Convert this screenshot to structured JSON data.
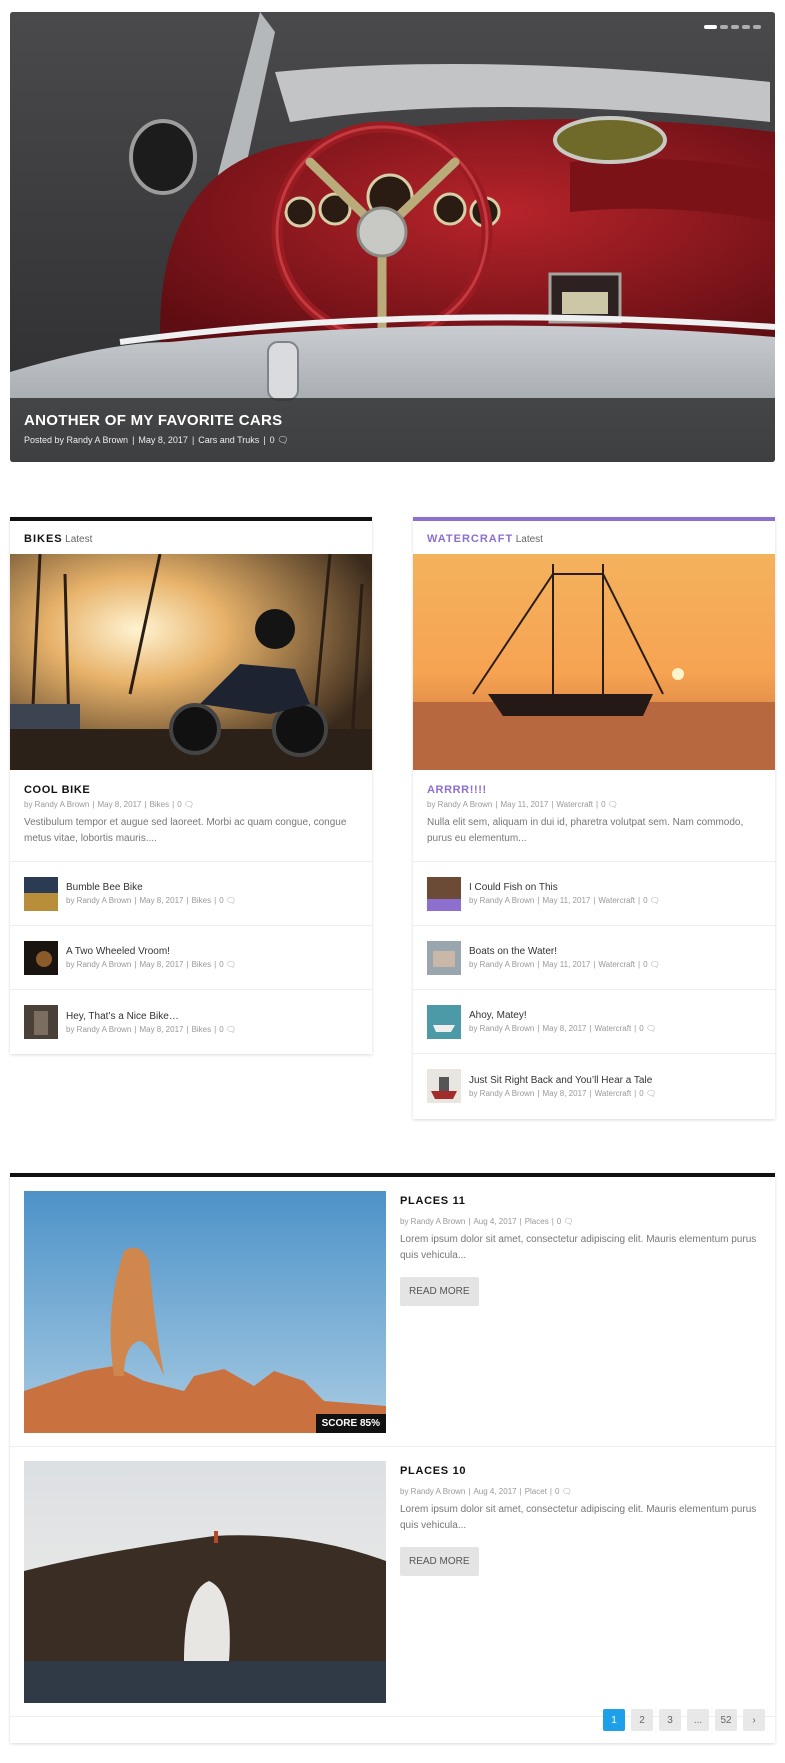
{
  "hero": {
    "title": "ANOTHER OF MY FAVORITE CARS",
    "posted_by": "Posted by Randy A Brown",
    "date": "May 8, 2017",
    "category": "Cars and Truks",
    "comments": "0",
    "comment_icon": "comment-icon",
    "dots": 5
  },
  "bikes": {
    "category": "BIKES",
    "latest": "Latest",
    "accent": "#111111",
    "main": {
      "title": "COOL BIKE",
      "author": "by Randy A Brown",
      "date": "May 8, 2017",
      "category": "Bikes",
      "comments": "0",
      "excerpt": "Vestibulum tempor et augue sed laoreet. Morbi ac quam congue, congue metus vitae, lobortis mauris...."
    },
    "items": [
      {
        "title": "Bumble Bee Bike",
        "author": "by Randy A Brown",
        "date": "May 8, 2017",
        "category": "Bikes",
        "comments": "0"
      },
      {
        "title": "A Two Wheeled Vroom!",
        "author": "by Randy A Brown",
        "date": "May 8, 2017",
        "category": "Bikes",
        "comments": "0"
      },
      {
        "title": "Hey, That’s a Nice Bike…",
        "author": "by Randy A Brown",
        "date": "May 8, 2017",
        "category": "Bikes",
        "comments": "0"
      }
    ]
  },
  "watercraft": {
    "category": "WATERCRAFT",
    "latest": "Latest",
    "accent": "#8c6fcf",
    "main": {
      "title": "ARRRR!!!!",
      "author": "by Randy A Brown",
      "date": "May 11, 2017",
      "category": "Watercraft",
      "comments": "0",
      "excerpt": "Nulla elit sem, aliquam in dui id, pharetra volutpat sem. Nam commodo, purus eu elementum..."
    },
    "items": [
      {
        "title": "I Could Fish on This",
        "author": "by Randy A Brown",
        "date": "May 11, 2017",
        "category": "Watercraft",
        "comments": "0"
      },
      {
        "title": "Boats on the Water!",
        "author": "by Randy A Brown",
        "date": "May 11, 2017",
        "category": "Watercraft",
        "comments": "0"
      },
      {
        "title": "Ahoy, Matey!",
        "author": "by Randy A Brown",
        "date": "May 8, 2017",
        "category": "Watercraft",
        "comments": "0"
      },
      {
        "title": "Just Sit Right Back and You’ll Hear a Tale",
        "author": "by Randy A Brown",
        "date": "May 8, 2017",
        "category": "Watercraft",
        "comments": "0"
      }
    ]
  },
  "places": [
    {
      "title": "PLACES 11",
      "author": "by Randy A Brown",
      "date": "Aug 4, 2017",
      "category": "Places",
      "comments": "0",
      "excerpt": "Lorem ipsum dolor sit amet, consectetur adipiscing elit. Mauris elementum purus quis vehicula...",
      "read_more": "READ MORE",
      "score": "SCORE 85%"
    },
    {
      "title": "PLACES 10",
      "author": "by Randy A Brown",
      "date": "Aug 4, 2017",
      "category": "Placet",
      "comments": "0",
      "excerpt": "Lorem ipsum dolor sit amet, consectetur adipiscing elit. Mauris elementum purus quis vehicula...",
      "read_more": "READ MORE"
    }
  ],
  "pagination": {
    "pages": [
      "1",
      "2",
      "3",
      "...",
      "52"
    ],
    "next": "›",
    "active": "1",
    "accent": "#1ea0e8"
  }
}
